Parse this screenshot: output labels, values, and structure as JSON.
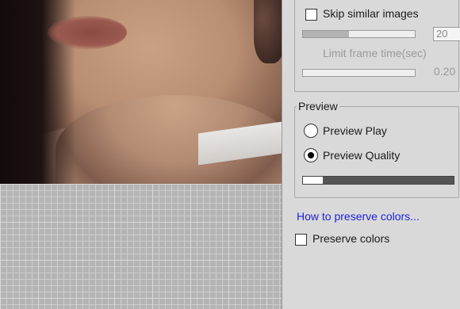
{
  "filter_group": {
    "skip_similar_label": "Skip similar images",
    "skip_similar_checked": false,
    "similarity_value": "20",
    "similarity_level": 0.41,
    "limit_frame_time_label": "Limit frame time(sec)",
    "limit_frame_time_value": "0.20",
    "limit_frame_time_level": 0.0
  },
  "preview_group": {
    "title": "Preview",
    "preview_play_label": "Preview Play",
    "preview_quality_label": "Preview Quality",
    "selected": "preview_quality",
    "quality_level": 0.13
  },
  "colors_section": {
    "link_text": "How to preserve colors...",
    "preserve_colors_label": "Preserve colors",
    "preserve_colors_checked": false
  },
  "colors": {
    "link": "#1f1fdd",
    "panel_bg": "#d9d9d9",
    "transparent_grid": "#b4b4b4"
  }
}
